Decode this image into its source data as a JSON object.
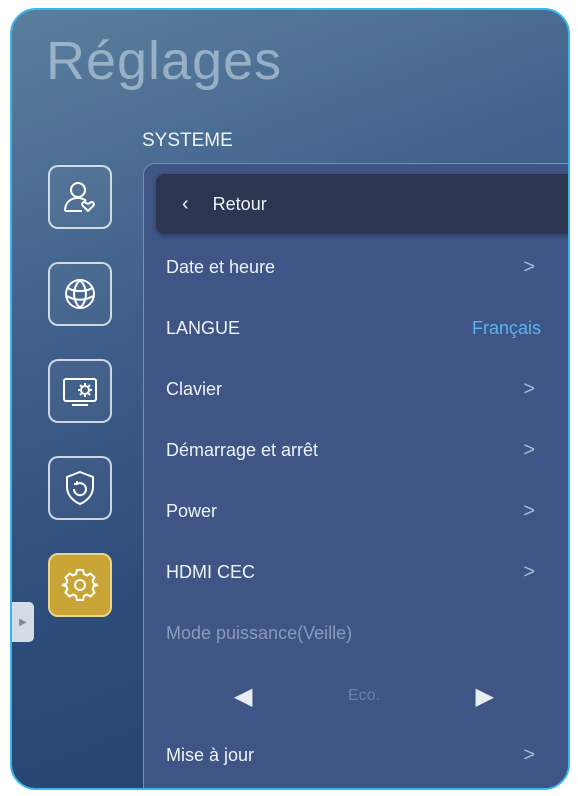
{
  "header": {
    "title": "Réglages",
    "section": "SYSTEME"
  },
  "sidebar": {
    "icons": [
      {
        "name": "user-heart-icon"
      },
      {
        "name": "globe-network-icon"
      },
      {
        "name": "display-gear-icon"
      },
      {
        "name": "shield-icon"
      },
      {
        "name": "gear-icon",
        "active": true
      }
    ]
  },
  "panel": {
    "back": {
      "label": "Retour"
    },
    "rows": [
      {
        "label": "Date et heure",
        "arrow": ">"
      },
      {
        "label": "LANGUE",
        "value": "Français"
      },
      {
        "label": "Clavier",
        "arrow": ">"
      },
      {
        "label": "Démarrage et arrêt",
        "arrow": ">"
      },
      {
        "label": "Power",
        "arrow": ">"
      },
      {
        "label": "HDMI CEC",
        "arrow": ">"
      },
      {
        "label": "Mode puissance(Veille)"
      },
      {
        "label": "Mise à jour",
        "arrow": ">"
      }
    ],
    "power_mode": {
      "value": "Eco."
    }
  },
  "colors": {
    "accent": "#c9a436",
    "frame": "#38b8ea",
    "value": "#58b6ec"
  }
}
